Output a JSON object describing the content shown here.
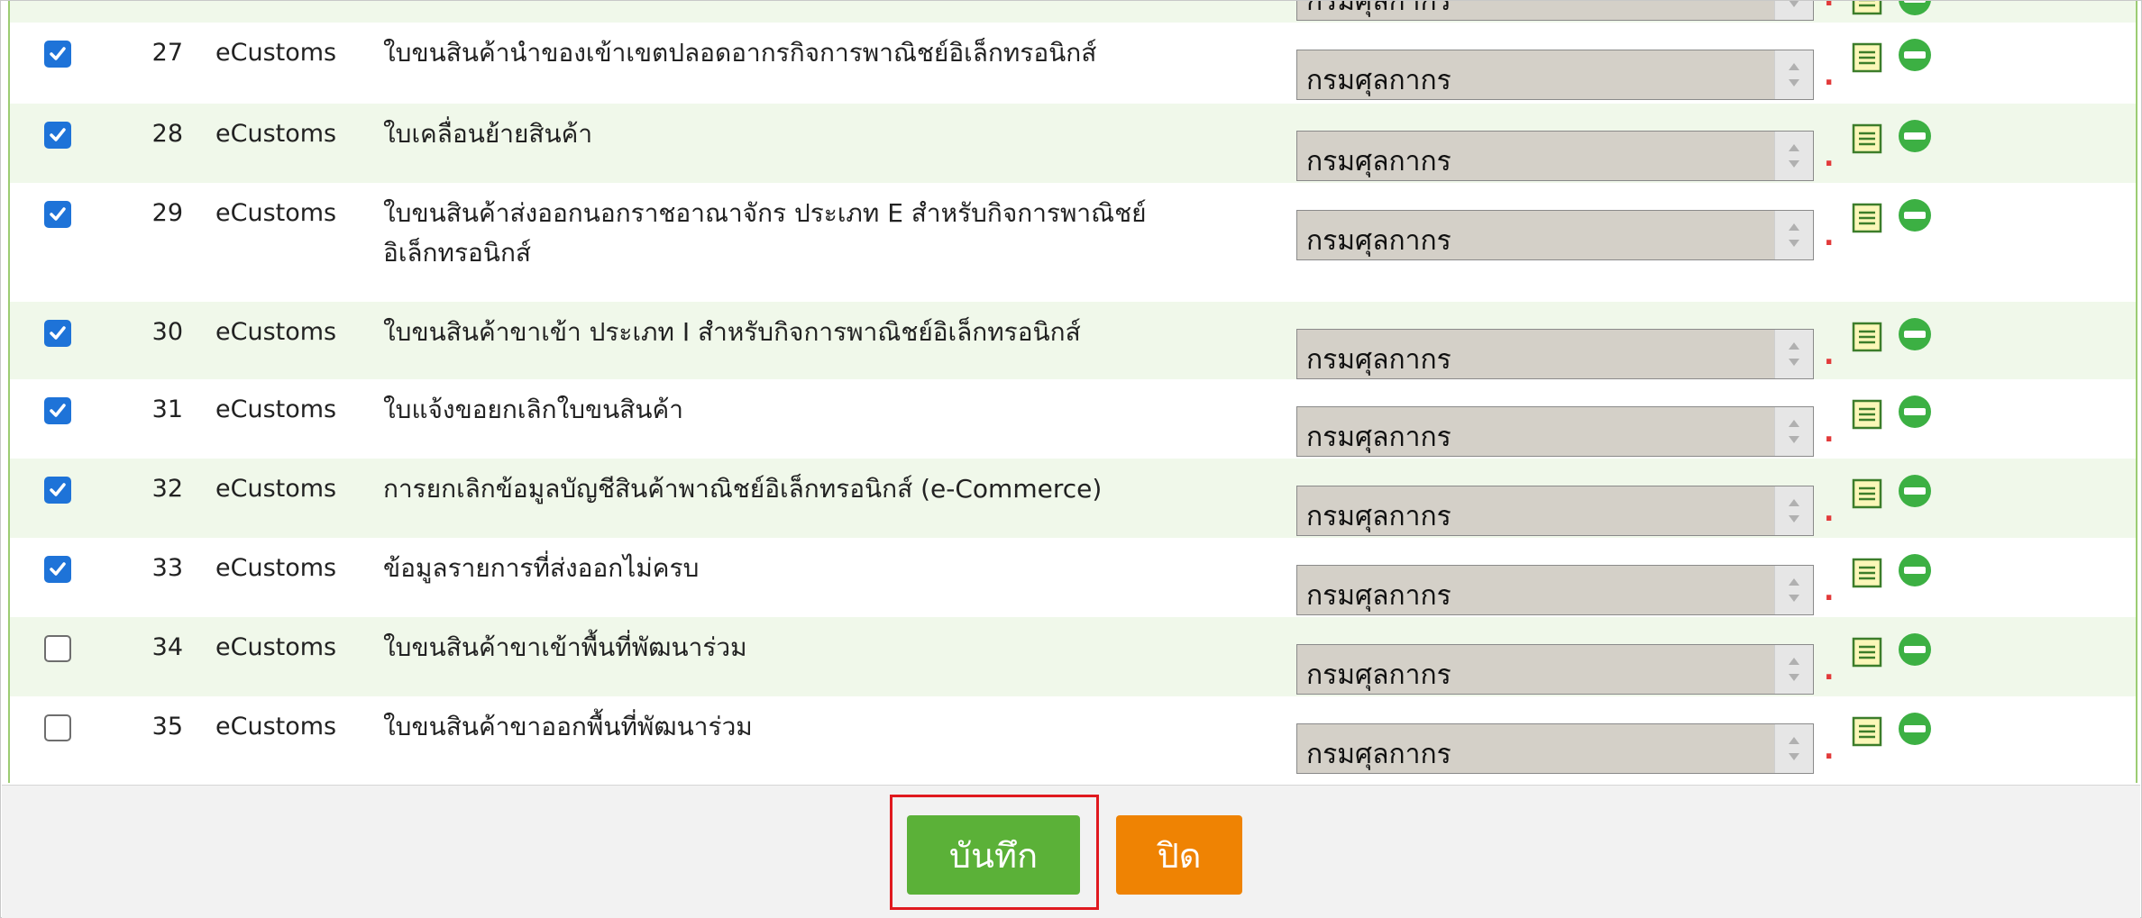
{
  "rows": [
    {
      "checked": true,
      "num": "27",
      "system": "eCustoms",
      "desc": "ใบขนสินค้านำของเข้าเขตปลอดอากรกิจการพาณิชย์อิเล็กทรอนิกส์",
      "agency": "กรมศุลกากร"
    },
    {
      "checked": true,
      "num": "28",
      "system": "eCustoms",
      "desc": "ใบเคลื่อนย้ายสินค้า",
      "agency": "กรมศุลกากร"
    },
    {
      "checked": true,
      "num": "29",
      "system": "eCustoms",
      "desc": "ใบขนสินค้าส่งออกนอกราชอาณาจักร ประเภท E สำหรับกิจการพาณิชย์ อิเล็กทรอนิกส์",
      "agency": "กรมศุลกากร"
    },
    {
      "checked": true,
      "num": "30",
      "system": "eCustoms",
      "desc": "ใบขนสินค้าขาเข้า ประเภท I สำหรับกิจการพาณิชย์อิเล็กทรอนิกส์",
      "agency": "กรมศุลกากร"
    },
    {
      "checked": true,
      "num": "31",
      "system": "eCustoms",
      "desc": "ใบแจ้งขอยกเลิกใบขนสินค้า",
      "agency": "กรมศุลกากร"
    },
    {
      "checked": true,
      "num": "32",
      "system": "eCustoms",
      "desc": "การยกเลิกข้อมูลบัญชีสินค้าพาณิชย์อิเล็กทรอนิกส์ (e-Commerce)",
      "agency": "กรมศุลกากร"
    },
    {
      "checked": true,
      "num": "33",
      "system": "eCustoms",
      "desc": "ข้อมูลรายการที่ส่งออกไม่ครบ",
      "agency": "กรมศุลกากร"
    },
    {
      "checked": false,
      "num": "34",
      "system": "eCustoms",
      "desc": "ใบขนสินค้าขาเข้าพื้นที่พัฒนาร่วม",
      "agency": "กรมศุลกากร"
    },
    {
      "checked": false,
      "num": "35",
      "system": "eCustoms",
      "desc": "ใบขนสินค้าขาออกพื้นที่พัฒนาร่วม",
      "agency": "กรมศุลกากร"
    }
  ],
  "partial_top_row": {
    "agency": "กรมศุลกากร"
  },
  "required_mark": ".",
  "buttons": {
    "save": "บันทึก",
    "close": "ปิด"
  },
  "icons": {
    "row_detail": "document-list-icon",
    "row_remove": "remove-circle-icon"
  },
  "colors": {
    "checkbox_checked": "#1e73d8",
    "row_alt": "#f0f8ea",
    "save_button": "#5bb138",
    "close_button": "#ef8303",
    "remove_icon": "#3cb043",
    "highlight": "#e0191f"
  }
}
